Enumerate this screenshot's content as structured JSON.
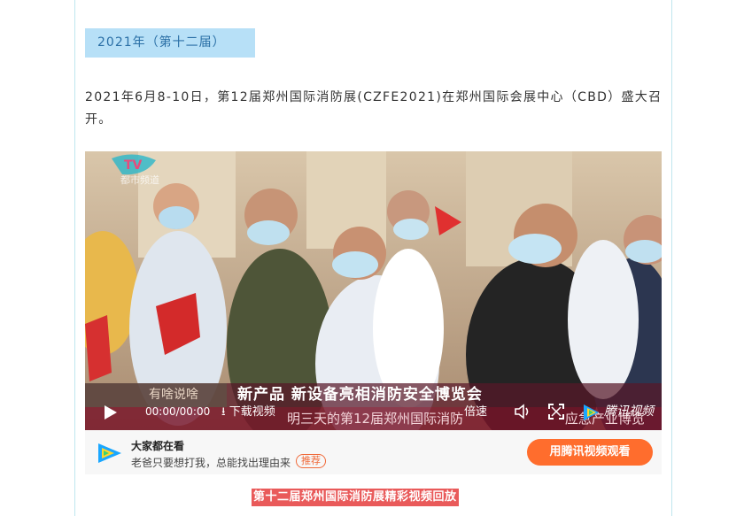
{
  "section_title": "2021年（第十二届）",
  "paragraph": "2021年6月8-10日，第12届郑州国际消防展(CZFE2021)在郑州国际会展中心（CBD）盛大召开。",
  "video": {
    "overlay_left": "有啥说啥",
    "overlay_headline": "新产品 新设备亮相消防安全博览会",
    "overlay_ticker": "明三天的第12届郑州国际消防",
    "overlay_ticker_tail": "应急产业博览",
    "time": "00:00/00:00",
    "download_label": "下载视频",
    "speed_label": "倍速",
    "brand_label": "腾讯视频",
    "tv_logo_text": "TV",
    "tv_channel_text": "都市频道"
  },
  "promo": {
    "title": "大家都在看",
    "subtitle": "老爸只要想打我，总能找出理由来",
    "badge": "推荐",
    "watch_button": "用腾讯视频观看"
  },
  "video_caption": "第十二届郑州国际消防展精彩视频回放",
  "colors": {
    "section_bg": "#b7e0f7",
    "section_text": "#2a6fa6",
    "watch_button": "#ff6d2d",
    "caption_bg": "#e95a5a"
  }
}
